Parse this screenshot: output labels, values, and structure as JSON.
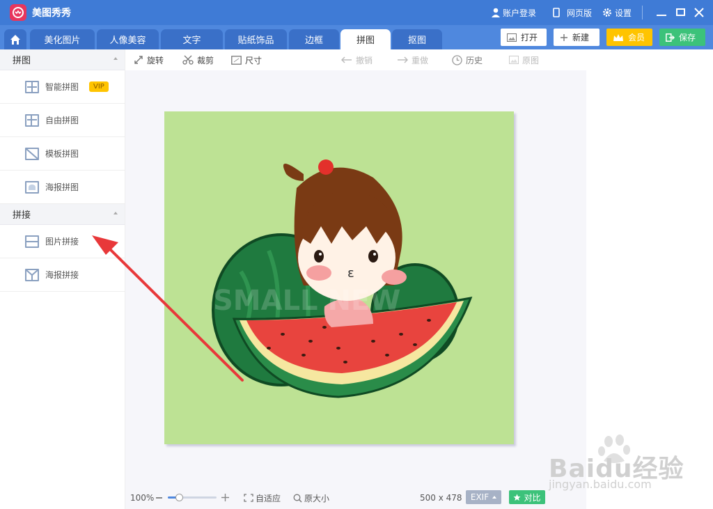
{
  "app": {
    "title": "美图秀秀"
  },
  "titlebar": {
    "account": "账户登录",
    "web": "网页版",
    "settings": "设置"
  },
  "tabs": [
    "美化图片",
    "人像美容",
    "文字",
    "贴纸饰品",
    "边框",
    "拼图",
    "抠图"
  ],
  "active_tab": "拼图",
  "header_buttons": {
    "open": "打开",
    "new": "新建",
    "member": "会员",
    "save": "保存"
  },
  "sidebar": {
    "sections": [
      {
        "title": "拼图",
        "items": [
          {
            "label": "智能拼图",
            "badge": "VIP"
          },
          {
            "label": "自由拼图"
          },
          {
            "label": "模板拼图"
          },
          {
            "label": "海报拼图"
          }
        ]
      },
      {
        "title": "拼接",
        "items": [
          {
            "label": "图片拼接"
          },
          {
            "label": "海报拼接"
          }
        ]
      }
    ]
  },
  "toolbar": {
    "rotate": "旋转",
    "crop": "裁剪",
    "size": "尺寸",
    "undo": "撤销",
    "redo": "重做",
    "history": "历史",
    "original": "原图"
  },
  "statusbar": {
    "zoom": "100%",
    "fit": "自适应",
    "actual": "原大小",
    "dims": "500 x 478",
    "exif": "EXIF",
    "compare": "对比"
  },
  "image_watermark": "SMALL NEW",
  "watermark": {
    "brand": "Baidu经验",
    "url": "jingyan.baidu.com"
  },
  "colors": {
    "titlebar": "#3f7bd6",
    "accent": "#ffc400",
    "save": "#3cc27a",
    "photo_bg": "#bde294",
    "arrow": "#e8383a"
  }
}
